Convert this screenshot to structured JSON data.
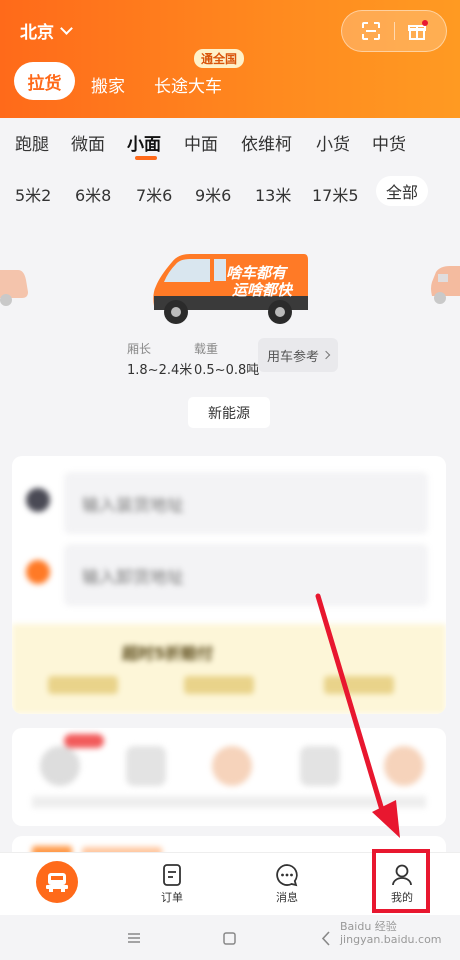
{
  "header": {
    "city": "北京",
    "tabs": [
      "拉货",
      "搬家",
      "长途大车"
    ],
    "badge": "通全国"
  },
  "vehicle_types": [
    "跑腿",
    "微面",
    "小面",
    "中面",
    "依维柯",
    "小货",
    "中货"
  ],
  "selected_vehicle": "小面",
  "sizes": [
    "5米2",
    "6米8",
    "7米6",
    "9米6",
    "13米",
    "17米5"
  ],
  "sizes_all": "全部",
  "van": {
    "ad_line1": "啥车都有",
    "ad_line2": "运啥都快"
  },
  "specs": {
    "length_label": "厢长",
    "length_value": "1.8~2.4米",
    "weight_label": "载重",
    "weight_value": "0.5~0.8吨",
    "ref_button": "用车参考"
  },
  "energy_button": "新能源",
  "form": {
    "from_placeholder": "输入装货地址",
    "to_placeholder": "输入卸货地址",
    "promo": "超时5折赔付"
  },
  "nav": {
    "orders": "订单",
    "messages": "消息",
    "me": "我的"
  },
  "watermark": "Baidu 经验\njingyan.baidu.com",
  "colors": {
    "brand": "#ff6a1a",
    "highlight": "#e8172f"
  }
}
